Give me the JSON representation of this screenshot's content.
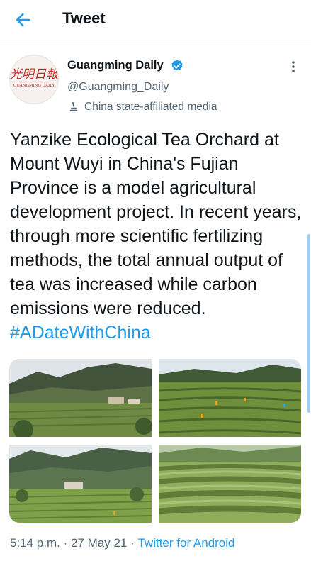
{
  "header": {
    "title": "Tweet",
    "back_icon": "arrow-left-icon"
  },
  "author": {
    "name": "Guangming Daily",
    "handle": "@Guangming_Daily",
    "affiliation": "China state-affiliated media",
    "avatar_text": "GUANGMING DAILY",
    "verified_icon": "verified-badge-icon"
  },
  "tweet": {
    "text": "Yanzike Ecological Tea Orchard at Mount Wuyi in China's Fujian Province is a model agricultural development project. In recent years, through more scientific fertilizing methods, the total annual output of tea was increased while carbon emissions were reduced. ",
    "hashtag": "#ADateWithChina"
  },
  "meta": {
    "time": "5:14 p.m.",
    "separator": " · ",
    "date": "27 May 21",
    "source": "Twitter for Android"
  },
  "colors": {
    "accent": "#1d9bf0",
    "text": "#0f1419",
    "secondary": "#536471"
  }
}
